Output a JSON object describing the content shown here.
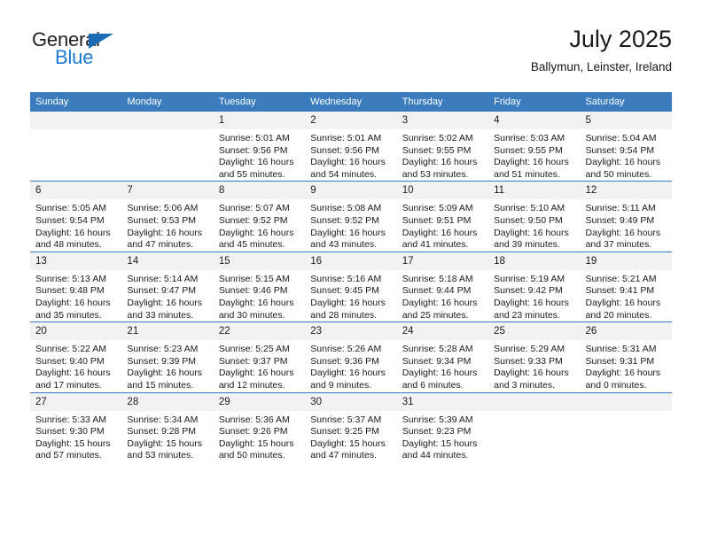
{
  "brand": {
    "name_top": "General",
    "name_bottom": "Blue",
    "triangle_color": "#1b6cb5",
    "blue_text_color": "#1b7ad1"
  },
  "header": {
    "title": "July 2025",
    "subtitle": "Ballymun, Leinster, Ireland"
  },
  "colors": {
    "header_row_bg": "#3a7cbe",
    "header_row_text": "#ffffff",
    "daynum_bg": "#f2f2f2",
    "row_separator": "#3a7cbe",
    "page_bg": "#ffffff"
  },
  "calendar": {
    "weekday_headers": [
      "Sunday",
      "Monday",
      "Tuesday",
      "Wednesday",
      "Thursday",
      "Friday",
      "Saturday"
    ],
    "weeks": [
      [
        {
          "day": "",
          "sunrise": "",
          "sunset": "",
          "daylight_line1": "",
          "daylight_line2": ""
        },
        {
          "day": "",
          "sunrise": "",
          "sunset": "",
          "daylight_line1": "",
          "daylight_line2": ""
        },
        {
          "day": "1",
          "sunrise": "Sunrise: 5:01 AM",
          "sunset": "Sunset: 9:56 PM",
          "daylight_line1": "Daylight: 16 hours",
          "daylight_line2": "and 55 minutes."
        },
        {
          "day": "2",
          "sunrise": "Sunrise: 5:01 AM",
          "sunset": "Sunset: 9:56 PM",
          "daylight_line1": "Daylight: 16 hours",
          "daylight_line2": "and 54 minutes."
        },
        {
          "day": "3",
          "sunrise": "Sunrise: 5:02 AM",
          "sunset": "Sunset: 9:55 PM",
          "daylight_line1": "Daylight: 16 hours",
          "daylight_line2": "and 53 minutes."
        },
        {
          "day": "4",
          "sunrise": "Sunrise: 5:03 AM",
          "sunset": "Sunset: 9:55 PM",
          "daylight_line1": "Daylight: 16 hours",
          "daylight_line2": "and 51 minutes."
        },
        {
          "day": "5",
          "sunrise": "Sunrise: 5:04 AM",
          "sunset": "Sunset: 9:54 PM",
          "daylight_line1": "Daylight: 16 hours",
          "daylight_line2": "and 50 minutes."
        }
      ],
      [
        {
          "day": "6",
          "sunrise": "Sunrise: 5:05 AM",
          "sunset": "Sunset: 9:54 PM",
          "daylight_line1": "Daylight: 16 hours",
          "daylight_line2": "and 48 minutes."
        },
        {
          "day": "7",
          "sunrise": "Sunrise: 5:06 AM",
          "sunset": "Sunset: 9:53 PM",
          "daylight_line1": "Daylight: 16 hours",
          "daylight_line2": "and 47 minutes."
        },
        {
          "day": "8",
          "sunrise": "Sunrise: 5:07 AM",
          "sunset": "Sunset: 9:52 PM",
          "daylight_line1": "Daylight: 16 hours",
          "daylight_line2": "and 45 minutes."
        },
        {
          "day": "9",
          "sunrise": "Sunrise: 5:08 AM",
          "sunset": "Sunset: 9:52 PM",
          "daylight_line1": "Daylight: 16 hours",
          "daylight_line2": "and 43 minutes."
        },
        {
          "day": "10",
          "sunrise": "Sunrise: 5:09 AM",
          "sunset": "Sunset: 9:51 PM",
          "daylight_line1": "Daylight: 16 hours",
          "daylight_line2": "and 41 minutes."
        },
        {
          "day": "11",
          "sunrise": "Sunrise: 5:10 AM",
          "sunset": "Sunset: 9:50 PM",
          "daylight_line1": "Daylight: 16 hours",
          "daylight_line2": "and 39 minutes."
        },
        {
          "day": "12",
          "sunrise": "Sunrise: 5:11 AM",
          "sunset": "Sunset: 9:49 PM",
          "daylight_line1": "Daylight: 16 hours",
          "daylight_line2": "and 37 minutes."
        }
      ],
      [
        {
          "day": "13",
          "sunrise": "Sunrise: 5:13 AM",
          "sunset": "Sunset: 9:48 PM",
          "daylight_line1": "Daylight: 16 hours",
          "daylight_line2": "and 35 minutes."
        },
        {
          "day": "14",
          "sunrise": "Sunrise: 5:14 AM",
          "sunset": "Sunset: 9:47 PM",
          "daylight_line1": "Daylight: 16 hours",
          "daylight_line2": "and 33 minutes."
        },
        {
          "day": "15",
          "sunrise": "Sunrise: 5:15 AM",
          "sunset": "Sunset: 9:46 PM",
          "daylight_line1": "Daylight: 16 hours",
          "daylight_line2": "and 30 minutes."
        },
        {
          "day": "16",
          "sunrise": "Sunrise: 5:16 AM",
          "sunset": "Sunset: 9:45 PM",
          "daylight_line1": "Daylight: 16 hours",
          "daylight_line2": "and 28 minutes."
        },
        {
          "day": "17",
          "sunrise": "Sunrise: 5:18 AM",
          "sunset": "Sunset: 9:44 PM",
          "daylight_line1": "Daylight: 16 hours",
          "daylight_line2": "and 25 minutes."
        },
        {
          "day": "18",
          "sunrise": "Sunrise: 5:19 AM",
          "sunset": "Sunset: 9:42 PM",
          "daylight_line1": "Daylight: 16 hours",
          "daylight_line2": "and 23 minutes."
        },
        {
          "day": "19",
          "sunrise": "Sunrise: 5:21 AM",
          "sunset": "Sunset: 9:41 PM",
          "daylight_line1": "Daylight: 16 hours",
          "daylight_line2": "and 20 minutes."
        }
      ],
      [
        {
          "day": "20",
          "sunrise": "Sunrise: 5:22 AM",
          "sunset": "Sunset: 9:40 PM",
          "daylight_line1": "Daylight: 16 hours",
          "daylight_line2": "and 17 minutes."
        },
        {
          "day": "21",
          "sunrise": "Sunrise: 5:23 AM",
          "sunset": "Sunset: 9:39 PM",
          "daylight_line1": "Daylight: 16 hours",
          "daylight_line2": "and 15 minutes."
        },
        {
          "day": "22",
          "sunrise": "Sunrise: 5:25 AM",
          "sunset": "Sunset: 9:37 PM",
          "daylight_line1": "Daylight: 16 hours",
          "daylight_line2": "and 12 minutes."
        },
        {
          "day": "23",
          "sunrise": "Sunrise: 5:26 AM",
          "sunset": "Sunset: 9:36 PM",
          "daylight_line1": "Daylight: 16 hours",
          "daylight_line2": "and 9 minutes."
        },
        {
          "day": "24",
          "sunrise": "Sunrise: 5:28 AM",
          "sunset": "Sunset: 9:34 PM",
          "daylight_line1": "Daylight: 16 hours",
          "daylight_line2": "and 6 minutes."
        },
        {
          "day": "25",
          "sunrise": "Sunrise: 5:29 AM",
          "sunset": "Sunset: 9:33 PM",
          "daylight_line1": "Daylight: 16 hours",
          "daylight_line2": "and 3 minutes."
        },
        {
          "day": "26",
          "sunrise": "Sunrise: 5:31 AM",
          "sunset": "Sunset: 9:31 PM",
          "daylight_line1": "Daylight: 16 hours",
          "daylight_line2": "and 0 minutes."
        }
      ],
      [
        {
          "day": "27",
          "sunrise": "Sunrise: 5:33 AM",
          "sunset": "Sunset: 9:30 PM",
          "daylight_line1": "Daylight: 15 hours",
          "daylight_line2": "and 57 minutes."
        },
        {
          "day": "28",
          "sunrise": "Sunrise: 5:34 AM",
          "sunset": "Sunset: 9:28 PM",
          "daylight_line1": "Daylight: 15 hours",
          "daylight_line2": "and 53 minutes."
        },
        {
          "day": "29",
          "sunrise": "Sunrise: 5:36 AM",
          "sunset": "Sunset: 9:26 PM",
          "daylight_line1": "Daylight: 15 hours",
          "daylight_line2": "and 50 minutes."
        },
        {
          "day": "30",
          "sunrise": "Sunrise: 5:37 AM",
          "sunset": "Sunset: 9:25 PM",
          "daylight_line1": "Daylight: 15 hours",
          "daylight_line2": "and 47 minutes."
        },
        {
          "day": "31",
          "sunrise": "Sunrise: 5:39 AM",
          "sunset": "Sunset: 9:23 PM",
          "daylight_line1": "Daylight: 15 hours",
          "daylight_line2": "and 44 minutes."
        },
        {
          "day": "",
          "sunrise": "",
          "sunset": "",
          "daylight_line1": "",
          "daylight_line2": ""
        },
        {
          "day": "",
          "sunrise": "",
          "sunset": "",
          "daylight_line1": "",
          "daylight_line2": ""
        }
      ]
    ]
  }
}
